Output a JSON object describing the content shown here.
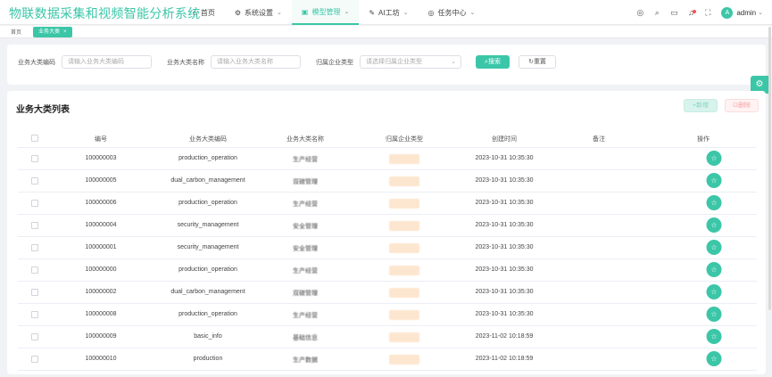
{
  "app": {
    "title": "物联数据采集和视频智能分析系统"
  },
  "nav": [
    {
      "label": "首页",
      "icon": "home-icon",
      "glyph": "⌂",
      "chevron": false
    },
    {
      "label": "系统设置",
      "icon": "settings-icon",
      "glyph": "⚙",
      "chevron": true
    },
    {
      "label": "模型管理",
      "icon": "model-icon",
      "glyph": "▣",
      "chevron": true,
      "active": true
    },
    {
      "label": "AI工坊",
      "icon": "ai-icon",
      "glyph": "✎",
      "chevron": true
    },
    {
      "label": "任务中心",
      "icon": "task-icon",
      "glyph": "◎",
      "chevron": true
    }
  ],
  "user": {
    "avatar": "A",
    "name": "admin"
  },
  "tabs": {
    "home": "首页",
    "active": "业务大类",
    "close": "×"
  },
  "search": {
    "code_label": "业务大类编码",
    "code_placeholder": "请输入业务大类编码",
    "name_label": "业务大类名称",
    "name_placeholder": "请输入业务大类名称",
    "type_label": "归属企业类型",
    "type_placeholder": "请选择归属企业类型",
    "search_btn": "搜索",
    "reset_btn": "重置"
  },
  "table": {
    "title": "业务大类列表",
    "add_btn": "新增",
    "delete_btn": "删除",
    "columns": [
      "编号",
      "业务大类编码",
      "业务大类名称",
      "归属企业类型",
      "创建时间",
      "备注",
      "操作"
    ],
    "rows": [
      {
        "id": "100000003",
        "code": "production_operation",
        "name": "生产经营",
        "created": "2023-10-31 10:35:30",
        "remark": ""
      },
      {
        "id": "100000005",
        "code": "dual_carbon_management",
        "name": "双碳管理",
        "created": "2023-10-31 10:35:30",
        "remark": ""
      },
      {
        "id": "100000006",
        "code": "production_operation",
        "name": "生产经营",
        "created": "2023-10-31 10:35:30",
        "remark": ""
      },
      {
        "id": "100000004",
        "code": "security_management",
        "name": "安全管理",
        "created": "2023-10-31 10:35:30",
        "remark": ""
      },
      {
        "id": "100000001",
        "code": "security_management",
        "name": "安全管理",
        "created": "2023-10-31 10:35:30",
        "remark": ""
      },
      {
        "id": "100000000",
        "code": "production_operation",
        "name": "生产经营",
        "created": "2023-10-31 10:35:30",
        "remark": ""
      },
      {
        "id": "100000002",
        "code": "dual_carbon_management",
        "name": "双碳管理",
        "created": "2023-10-31 10:35:30",
        "remark": ""
      },
      {
        "id": "100000008",
        "code": "production_operation",
        "name": "生产经营",
        "created": "2023-10-31 10:35:30",
        "remark": ""
      },
      {
        "id": "100000009",
        "code": "basic_info",
        "name": "基础信息",
        "created": "2023-11-02 10:18:59",
        "remark": ""
      },
      {
        "id": "100000010",
        "code": "production",
        "name": "生产数据",
        "created": "2023-11-02 10:18:59",
        "remark": ""
      }
    ]
  },
  "colors": {
    "accent": "#3cc6a8",
    "tag_blur": "#fde6cf",
    "danger": "#f5a3a3"
  }
}
